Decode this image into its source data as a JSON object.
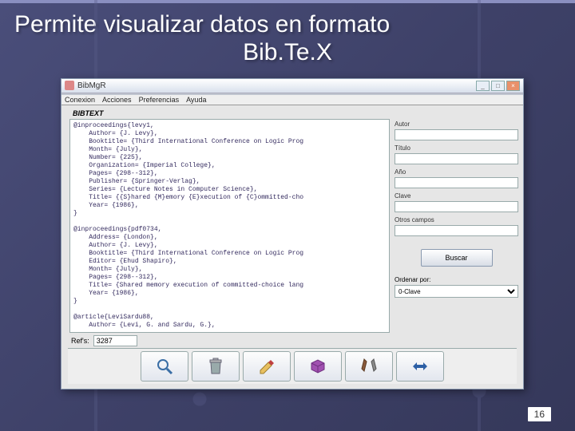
{
  "slide": {
    "title_line1": "Permite visualizar datos en formato",
    "title_line2": "Bib.Te.X",
    "page_number": "16"
  },
  "window": {
    "title": "BibMgR",
    "menus": [
      "Conexion",
      "Acciones",
      "Preferencias",
      "Ayuda"
    ],
    "bibtext_label": "BIBTEXT",
    "bibtext_content": "@inproceedings{levy1,\n    Author= {J. Levy},\n    Booktitle= {Third International Conference on Logic Prog\n    Month= {July},\n    Number= {225},\n    Organization= {Imperial College},\n    Pages= {298--312},\n    Publisher= {Springer-Verlag},\n    Series= {Lecture Notes in Computer Science},\n    Title= {{S}hared {M}emory {E}xecution of {C}ommitted-cho\n    Year= {1986},\n}\n\n@inproceedings{pdf0734,\n    Address= {London},\n    Author= {J. Levy},\n    Booktitle= {Third International Conference on Logic Prog\n    Editor= {Ehud Shapiro},\n    Month= {July},\n    Pages= {298--312},\n    Title= {Shared memory execution of committed-choice lang\n    Year= {1986},\n}\n\n@article{LeviSardu88,\n    Author= {Levi, G. and Sardu, G.},",
    "refs_label": "Ref's:",
    "refs_value": "3287",
    "fields": {
      "autor": "Autor",
      "titulo": "Título",
      "ano": "Año",
      "clave": "Clave",
      "otros": "Otros campos"
    },
    "search_button": "Buscar",
    "order_label": "Ordenar por:",
    "order_value": "0-Clave"
  },
  "icons": {
    "search": "search-icon",
    "trash": "trash-icon",
    "edit": "edit-icon",
    "package": "package-icon",
    "tools": "tools-icon",
    "arrows": "arrows-icon"
  }
}
